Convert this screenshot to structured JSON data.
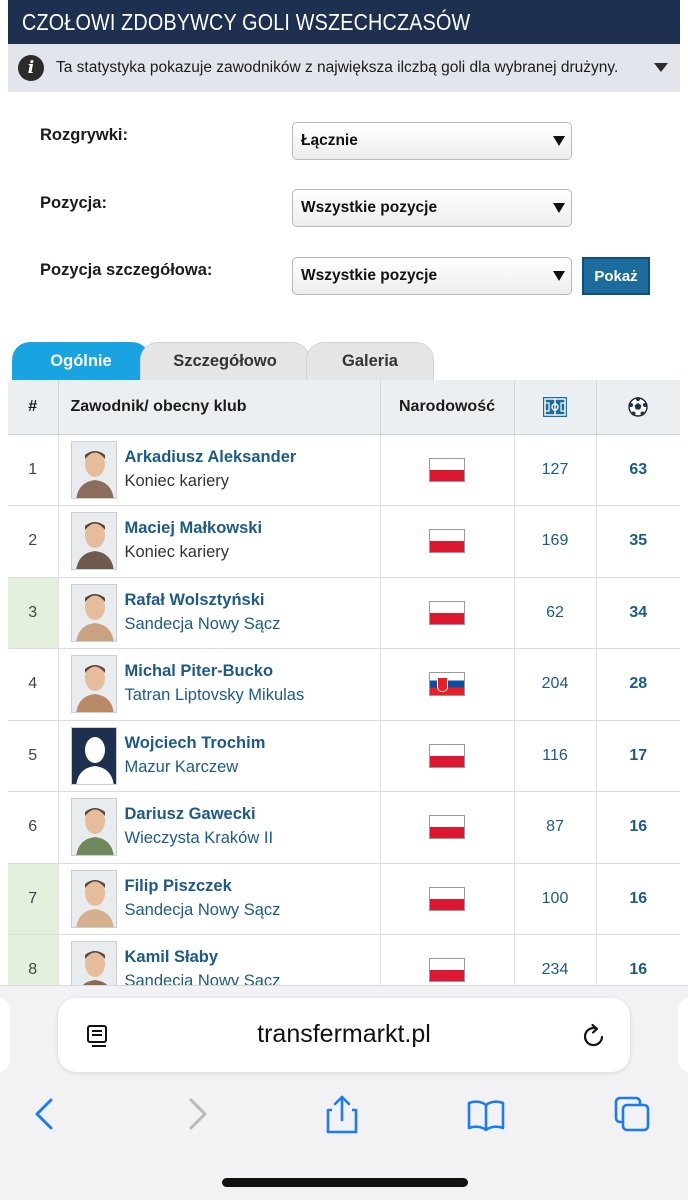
{
  "header": {
    "title": "CZOŁOWI ZDOBYWCY GOLI WSZECHCZASÓW",
    "info": "Ta statystyka pokazuje zawodników z największa ilczbą goli dla wybranej drużyny."
  },
  "filters": {
    "competition_label": "Rozgrywki:",
    "competition_value": "Łącznie",
    "position_label": "Pozycja:",
    "position_value": "Wszystkie pozycje",
    "detailed_label": "Pozycja szczegółowa:",
    "detailed_value": "Wszystkie pozycje",
    "show_button": "Pokaż"
  },
  "tabs": [
    "Ogólnie",
    "Szczegółowo",
    "Galeria"
  ],
  "table": {
    "headers": {
      "rank": "#",
      "player": "Zawodnik/ obecny klub",
      "nationality": "Narodowość",
      "apps_icon": "pitch-icon",
      "goals_icon": "football-icon"
    },
    "rows": [
      {
        "rank": "1",
        "name": "Arkadiusz Aleksander",
        "club": "Koniec kariery",
        "club_link": false,
        "flag": "pl",
        "apps": "127",
        "goals": "63",
        "highlight": false
      },
      {
        "rank": "2",
        "name": "Maciej Małkowski",
        "club": "Koniec kariery",
        "club_link": false,
        "flag": "pl",
        "apps": "169",
        "goals": "35",
        "highlight": false
      },
      {
        "rank": "3",
        "name": "Rafał Wolsztyński",
        "club": "Sandecja Nowy Sącz",
        "club_link": true,
        "flag": "pl",
        "apps": "62",
        "goals": "34",
        "highlight": true
      },
      {
        "rank": "4",
        "name": "Michal Piter-Bucko",
        "club": "Tatran Liptovsky Mikulas",
        "club_link": true,
        "flag": "sk",
        "apps": "204",
        "goals": "28",
        "highlight": false
      },
      {
        "rank": "5",
        "name": "Wojciech Trochim",
        "club": "Mazur Karczew",
        "club_link": true,
        "flag": "pl",
        "apps": "116",
        "goals": "17",
        "highlight": false
      },
      {
        "rank": "6",
        "name": "Dariusz Gawecki",
        "club": "Wieczysta Kraków II",
        "club_link": true,
        "flag": "pl",
        "apps": "87",
        "goals": "16",
        "highlight": false
      },
      {
        "rank": "7",
        "name": "Filip Piszczek",
        "club": "Sandecja Nowy Sącz",
        "club_link": true,
        "flag": "pl",
        "apps": "100",
        "goals": "16",
        "highlight": true
      },
      {
        "rank": "8",
        "name": "Kamil Słaby",
        "club": "Sandecja Nowy Sącz",
        "club_link": true,
        "flag": "pl",
        "apps": "234",
        "goals": "16",
        "highlight": true
      }
    ]
  },
  "browser": {
    "url": "transfermarkt.pl"
  }
}
